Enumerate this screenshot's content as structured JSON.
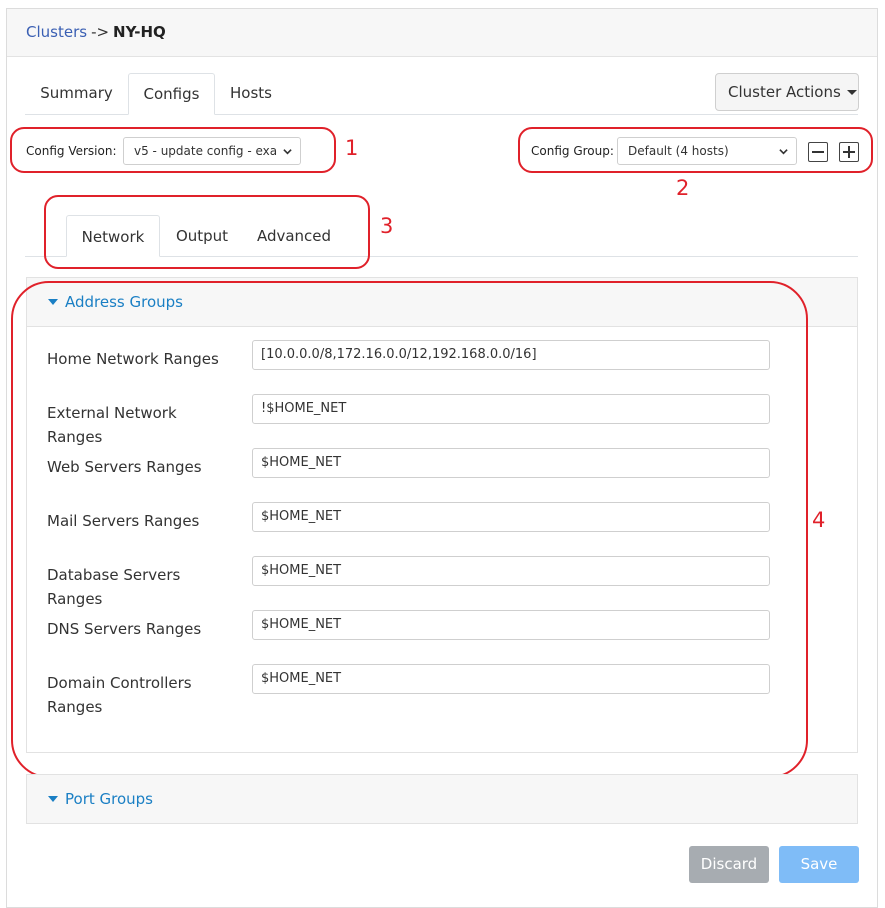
{
  "breadcrumb": {
    "parent": "Clusters",
    "separator": "->",
    "current": "NY-HQ"
  },
  "tabs": [
    {
      "label": "Summary"
    },
    {
      "label": "Configs"
    },
    {
      "label": "Hosts"
    }
  ],
  "cluster_actions_label": "Cluster Actions",
  "config_version": {
    "label": "Config Version:",
    "value": "v5 - update config - exa"
  },
  "config_group": {
    "label": "Config Group:",
    "value": "Default (4 hosts)"
  },
  "annotations": [
    "1",
    "2",
    "3",
    "4"
  ],
  "subtabs": [
    {
      "label": "Network"
    },
    {
      "label": "Output"
    },
    {
      "label": "Advanced"
    }
  ],
  "address_groups": {
    "title": "Address Groups",
    "rows": [
      {
        "label": "Home Network Ranges",
        "value": "[10.0.0.0/8,172.16.0.0/12,192.168.0.0/16]"
      },
      {
        "label": "External Network Ranges",
        "value": "!$HOME_NET"
      },
      {
        "label": "Web Servers Ranges",
        "value": "$HOME_NET"
      },
      {
        "label": "Mail Servers Ranges",
        "value": "$HOME_NET"
      },
      {
        "label": "Database Servers Ranges",
        "value": "$HOME_NET"
      },
      {
        "label": "DNS Servers Ranges",
        "value": "$HOME_NET"
      },
      {
        "label": "Domain Controllers Ranges",
        "value": "$HOME_NET"
      }
    ]
  },
  "port_groups": {
    "title": "Port Groups"
  },
  "buttons": {
    "discard": "Discard",
    "save": "Save"
  },
  "colors": {
    "link": "#3a5fb3",
    "accent": "#1a7fc4",
    "annotation": "#e0212a",
    "discard": "#a7acb1",
    "save": "#7fbcf7"
  }
}
